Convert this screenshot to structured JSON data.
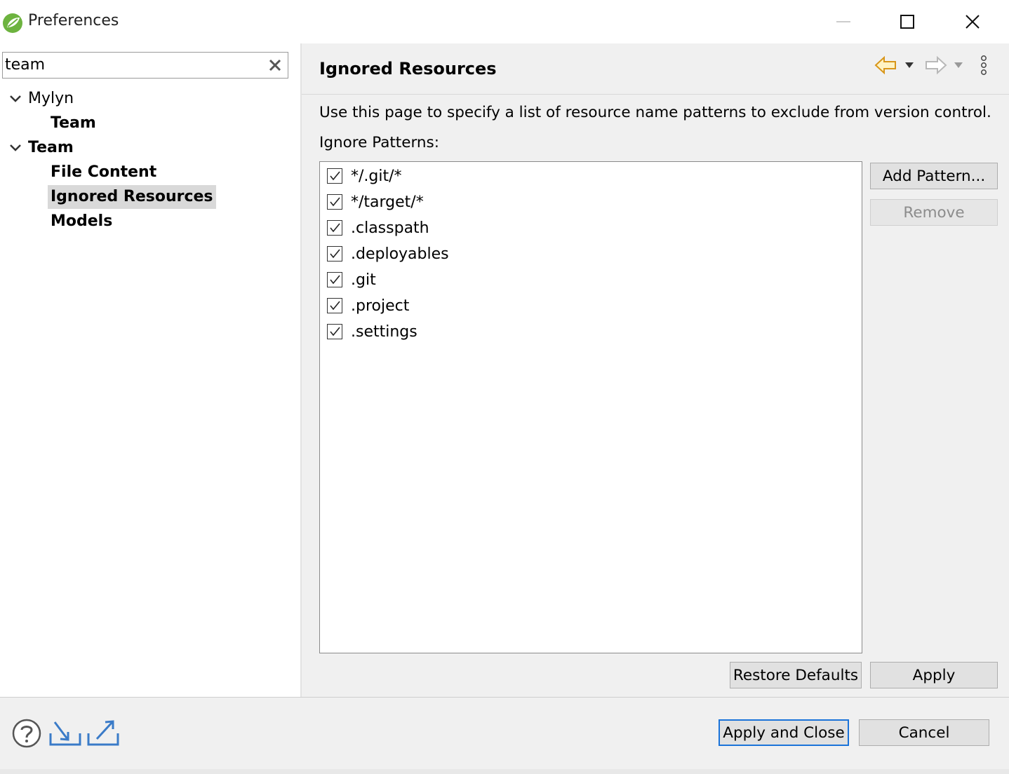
{
  "window": {
    "title": "Preferences"
  },
  "filter": {
    "value": "team"
  },
  "tree": {
    "items": [
      {
        "label": "Mylyn",
        "level": 0,
        "expanded": true
      },
      {
        "label": "Team",
        "level": 1
      },
      {
        "label": "Team",
        "level": 0,
        "expanded": true
      },
      {
        "label": "File Content",
        "level": 1
      },
      {
        "label": "Ignored Resources",
        "level": 1,
        "selected": true
      },
      {
        "label": "Models",
        "level": 1
      }
    ]
  },
  "page": {
    "title": "Ignored Resources",
    "description": "Use this page to specify a list of resource name patterns to exclude from version control.",
    "patterns_label": "Ignore Patterns:",
    "patterns": [
      {
        "text": "*/.git/*",
        "checked": true
      },
      {
        "text": "*/target/*",
        "checked": true
      },
      {
        "text": ".classpath",
        "checked": true
      },
      {
        "text": ".deployables",
        "checked": true
      },
      {
        "text": ".git",
        "checked": true
      },
      {
        "text": ".project",
        "checked": true
      },
      {
        "text": ".settings",
        "checked": true
      }
    ],
    "add_pattern_label": "Add Pattern...",
    "remove_label": "Remove",
    "restore_defaults_label": "Restore Defaults",
    "apply_label": "Apply"
  },
  "footer": {
    "apply_close_label": "Apply and Close",
    "cancel_label": "Cancel"
  },
  "icons": {
    "app": "spring-leaf-icon",
    "help": "help-icon",
    "import": "import-icon",
    "export": "export-icon",
    "back": "back-arrow-icon",
    "forward": "forward-arrow-icon",
    "menu": "view-menu-icon"
  },
  "colors": {
    "accent": "#1a73d9",
    "back_arrow": "#e8a317",
    "selection": "#d9d9d9"
  }
}
